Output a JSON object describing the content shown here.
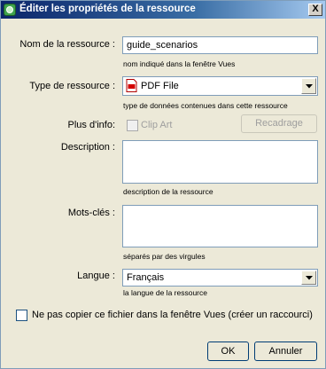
{
  "dialog": {
    "title": "Éditer les propriétés de la ressource",
    "close_label": "X"
  },
  "form": {
    "name": {
      "label": "Nom de la ressource :",
      "value": "guide_scenarios",
      "hint": "nom indiqué dans la fenêtre Vues"
    },
    "type": {
      "label": "Type de ressource :",
      "selected": "PDF File",
      "icon": "pdf-file-icon",
      "hint": "type de données contenues dans cette ressource"
    },
    "more_info": {
      "label": "Plus d'info:",
      "clipart_label": "Clip Art",
      "clipart_checked": false,
      "reframe_label": "Recadrage"
    },
    "description": {
      "label": "Description :",
      "value": "",
      "hint": "description de la ressource"
    },
    "keywords": {
      "label": "Mots-clés :",
      "value": "",
      "hint": "séparés par des virgules"
    },
    "language": {
      "label": "Langue :",
      "selected": "Français",
      "hint": "la langue de la ressource"
    },
    "no_copy": {
      "label": "Ne pas copier ce fichier dans la fenêtre Vues (créer un raccourci)",
      "checked": false
    }
  },
  "buttons": {
    "ok_label": "OK",
    "cancel_label": "Annuler"
  },
  "colors": {
    "titlebar": "#0a246a",
    "window_bg": "#ece9d8",
    "field_border": "#7f9db9"
  }
}
